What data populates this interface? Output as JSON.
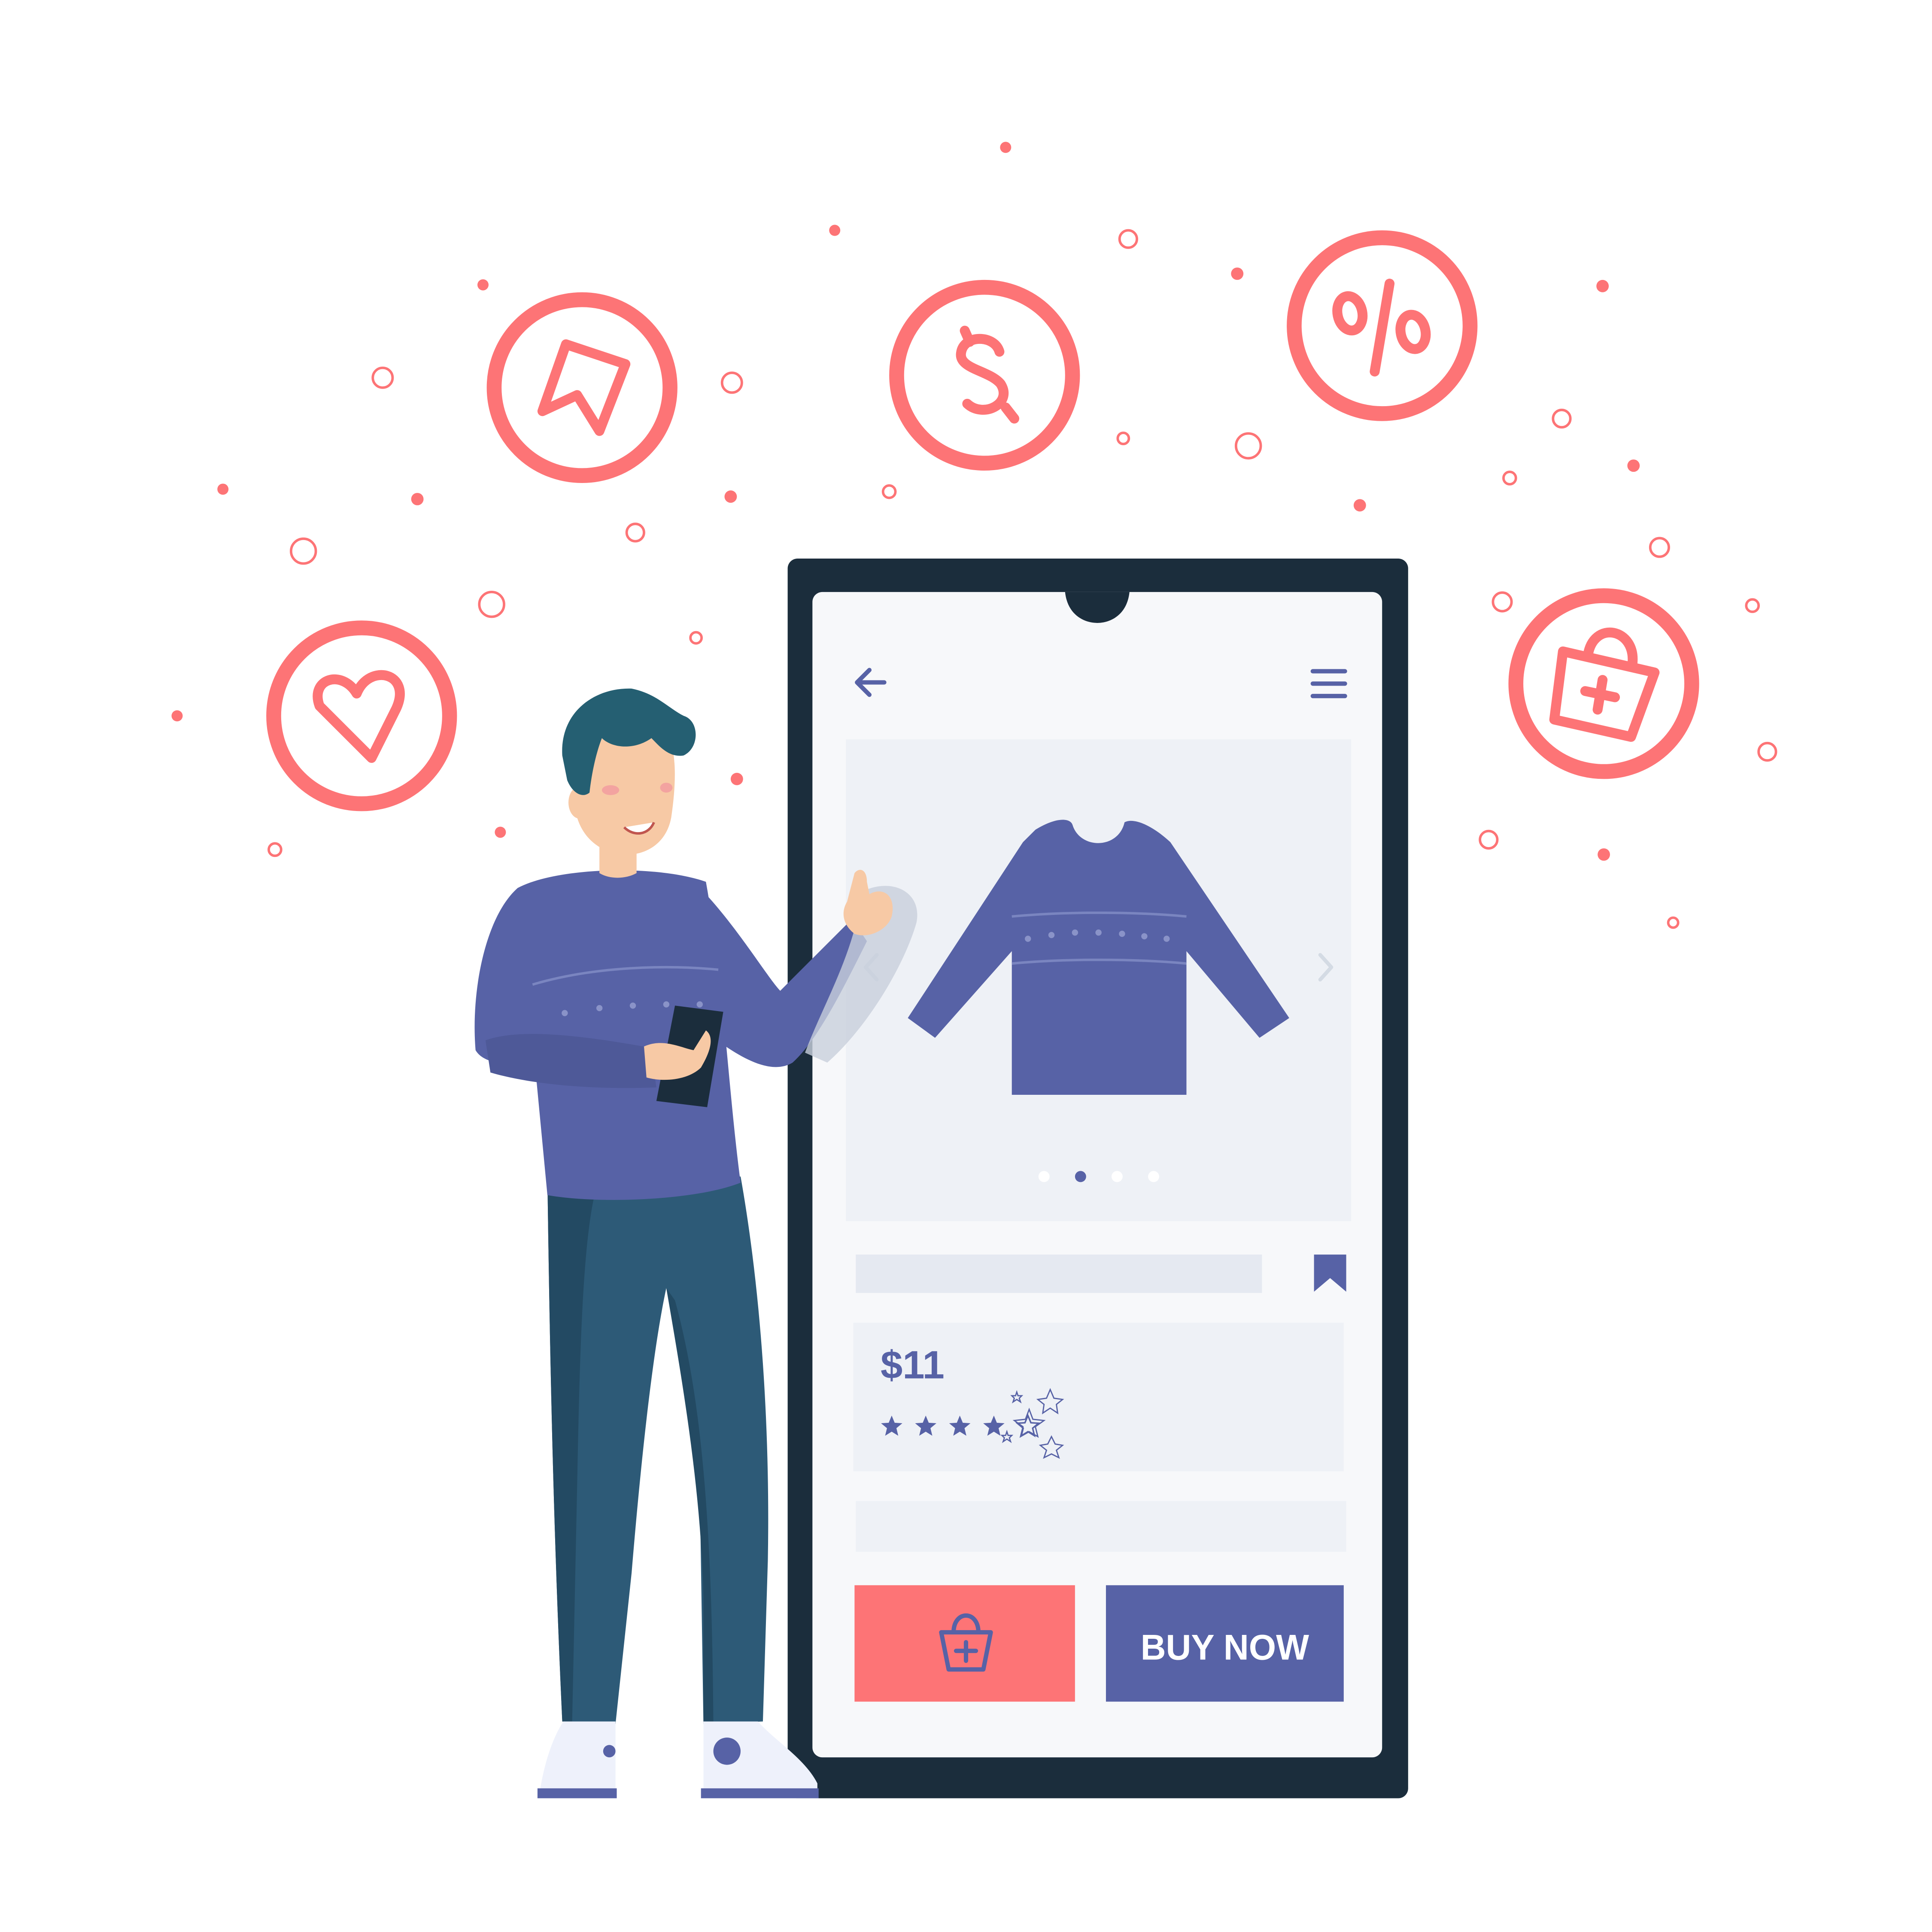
{
  "product": {
    "price": "$11",
    "rating": 4,
    "rating_max": 5,
    "carousel_active_index": 1,
    "carousel_count": 4
  },
  "actions": {
    "add_to_cart_icon": "shopping-bag-plus-icon",
    "buy_now_label": "BUY NOW"
  },
  "top_bar": {
    "back_icon": "arrow-left-icon",
    "menu_icon": "hamburger-menu-icon"
  },
  "floating_icons": [
    "heart-icon",
    "cursor-tag-icon",
    "dollar-icon",
    "percent-icon",
    "shopping-bag-plus-icon"
  ],
  "colors": {
    "accent_coral": "#fd7476",
    "brand_indigo": "#5762a6",
    "phone_frame": "#1b2d3c",
    "screen_bg": "#f7f8fa",
    "card_bg": "#eef1f6",
    "pants": "#2d5a77",
    "skin": "#f7c9a5",
    "hair": "#255f72"
  }
}
